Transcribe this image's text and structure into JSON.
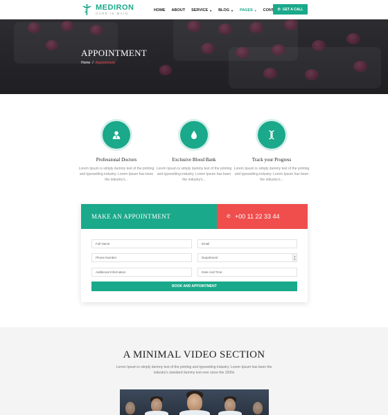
{
  "brand": {
    "name": "MEDIRON",
    "tagline": "CARE IS MAIN"
  },
  "nav": {
    "items": [
      {
        "label": "HOME",
        "caret": false,
        "active": false
      },
      {
        "label": "ABOUT",
        "caret": false,
        "active": false
      },
      {
        "label": "SERVICE",
        "caret": true,
        "active": false
      },
      {
        "label": "BLOG",
        "caret": true,
        "active": false
      },
      {
        "label": "PAGES",
        "caret": true,
        "active": true
      },
      {
        "label": "CONTACT",
        "caret": false,
        "active": false
      }
    ],
    "cta": "GET A CALL"
  },
  "banner": {
    "title": "APPOINTMENT",
    "breadcrumb": {
      "home": "Home",
      "separator": "/",
      "current": "Appointment"
    }
  },
  "features": [
    {
      "icon": "doctor-icon",
      "title": "Professional Doctors",
      "text": "Lorem Ipsum is simply dummy text of the printing and typesetting industry. Lorem Ipsum has been the industry's..."
    },
    {
      "icon": "blood-drop-icon",
      "title": "Exclusive Blood Bank",
      "text": "Lorem Ipsum is simply dummy text of the printing and typesetting industry. Lorem Ipsum has been the industry's..."
    },
    {
      "icon": "dna-icon",
      "title": "Track your Progress",
      "text": "Lorem Ipsum is simply dummy text of the printing and typesetting industry. Lorem Ipsum has been the industry's..."
    }
  ],
  "appointment": {
    "heading": "MAKE AN APPOINTMENT",
    "phone": "+00 11 22 33 44",
    "fields": {
      "full_name": "Full Name",
      "email": "Email",
      "phone": "Phone Number",
      "department": "Department",
      "additional": "Additional Information",
      "datetime": "Date And Time"
    },
    "button": "BOOK AND APPOINTMENT"
  },
  "video": {
    "title": "A MINIMAL VIDEO SECTION",
    "text": "Lorem Ipsum is simply dummy text of the printing and typesetting industry. Lorem Ipsum has been the industry's standard dummy text ever since the 1500s"
  },
  "colors": {
    "primary": "#1aa98a",
    "accent": "#f04d4d",
    "dark": "#222222"
  }
}
